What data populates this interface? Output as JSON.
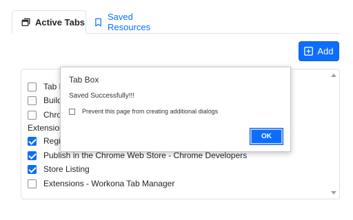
{
  "tabs": [
    {
      "label": "Active Tabs",
      "icon": "window-icon",
      "active": true
    },
    {
      "label": "Saved Resources",
      "icon": "bookmark-icon",
      "active": false
    }
  ],
  "toolbar": {
    "add_label": "Add",
    "add_icon": "plus-square-icon"
  },
  "list": {
    "items": [
      {
        "label": "Tab M",
        "checked": false
      },
      {
        "label": "Build",
        "checked": false
      },
      {
        "label": "Chron",
        "checked": false
      }
    ],
    "group_label": "Extension",
    "group_items": [
      {
        "label": "Regis",
        "checked": true
      },
      {
        "label": "Publish in the Chrome Web Store - Chrome Developers",
        "checked": true
      },
      {
        "label": "Store Listing",
        "checked": true
      },
      {
        "label": "Extensions - Workona Tab Manager",
        "checked": false
      }
    ]
  },
  "dialog": {
    "title": "Tab Box",
    "message": "Saved Successfully!!!",
    "checkbox_label": "Prevent this page from creating additional dialogs",
    "ok_label": "OK"
  },
  "colors": {
    "accent": "#0d6efd",
    "border": "#dee2e6"
  }
}
